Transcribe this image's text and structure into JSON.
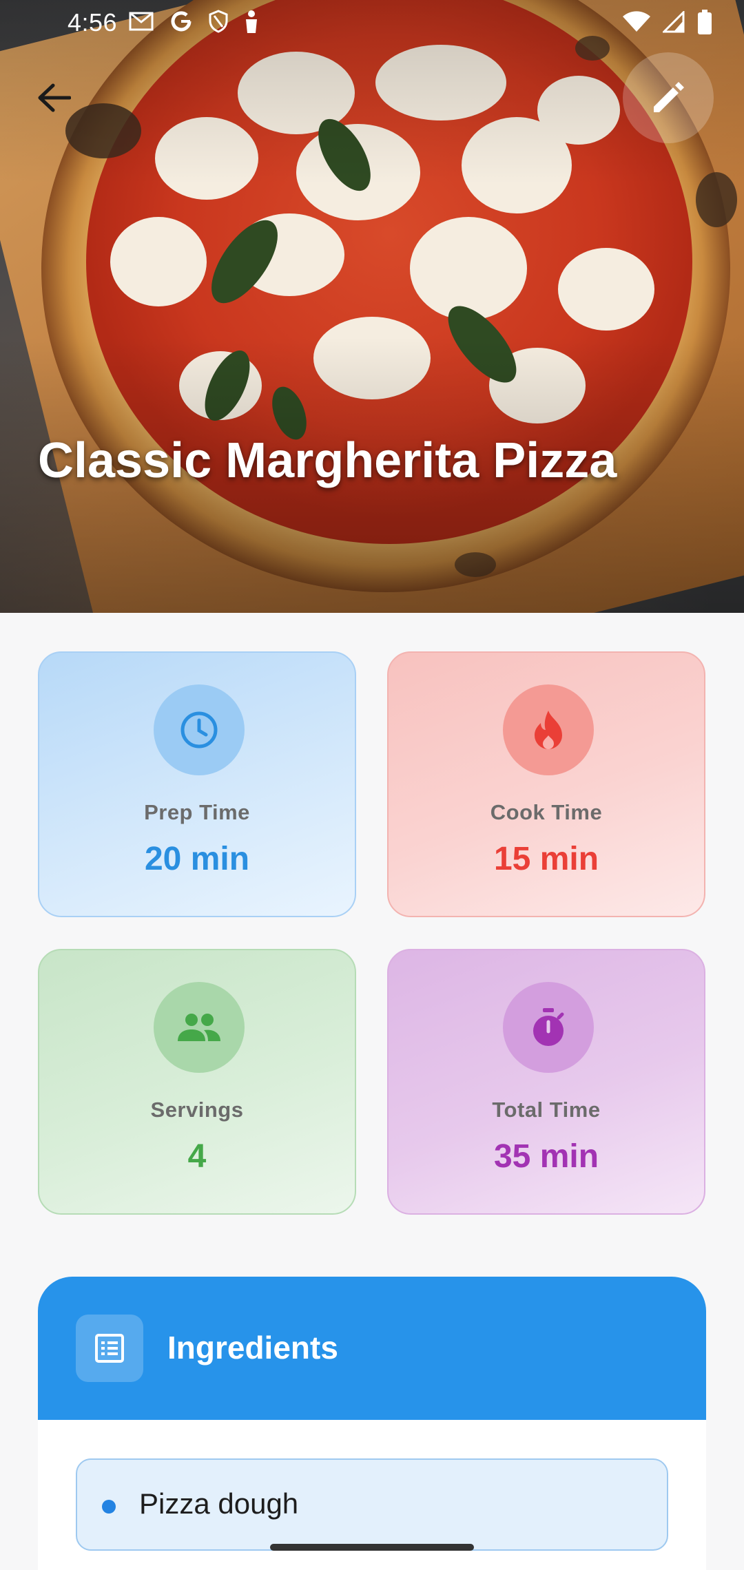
{
  "status_bar": {
    "time": "4:56",
    "left_icons": [
      "gmail-icon",
      "google-icon",
      "shield-icon",
      "person-icon"
    ],
    "right_icons": [
      "wifi-icon",
      "signal-icon",
      "battery-icon"
    ]
  },
  "header": {
    "back_icon": "arrow-back-icon",
    "edit_icon": "pencil-icon"
  },
  "recipe": {
    "title": "Classic Margherita Pizza"
  },
  "stats": [
    {
      "label": "Prep Time",
      "value": "20 min",
      "icon": "clock-icon",
      "color": "#2a8fe0"
    },
    {
      "label": "Cook Time",
      "value": "15 min",
      "icon": "flame-icon",
      "color": "#ea3f37"
    },
    {
      "label": "Servings",
      "value": "4",
      "icon": "people-icon",
      "color": "#45a849"
    },
    {
      "label": "Total Time",
      "value": "35 min",
      "icon": "timer-icon",
      "color": "#a233b3"
    }
  ],
  "ingredients": {
    "title": "Ingredients",
    "icon": "list-icon",
    "items": [
      "Pizza dough"
    ],
    "accent": "#2793ea"
  }
}
